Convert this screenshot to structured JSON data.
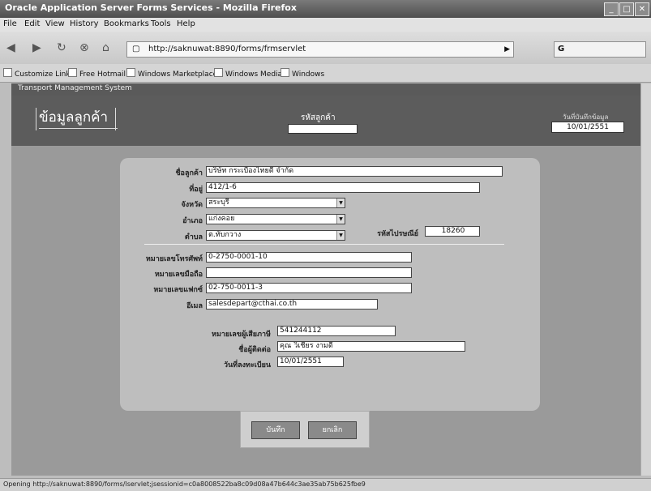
{
  "window": {
    "title": "Oracle Application Server Forms Services - Mozilla Firefox"
  },
  "menu": [
    "File",
    "Edit",
    "View",
    "History",
    "Bookmarks",
    "Tools",
    "Help"
  ],
  "nav": {
    "url": "http://saknuwat:8890/forms/frmservlet",
    "search_placeholder": "G"
  },
  "bookmarks": [
    "Customize Links",
    "Free Hotmail",
    "Windows Marketplace",
    "Windows Media",
    "Windows"
  ],
  "app": {
    "bar_title": "Transport Management System",
    "header_title": "ข้อมูลลูกค้า",
    "customer_code_label": "รหัสลูกค้า",
    "customer_code_value": "",
    "record_date_label": "วันที่บันทึกข้อมูล",
    "record_date_value": "10/01/2551"
  },
  "form": {
    "name": {
      "label": "ชื่อลูกค้า",
      "value": "บริษัท กระเบื้องไทยดี จำกัด"
    },
    "address": {
      "label": "ที่อยู่",
      "value": "412/1-6"
    },
    "province": {
      "label": "จังหวัด",
      "value": "สระบุรี"
    },
    "district": {
      "label": "อำเภอ",
      "value": "แก่งคอย"
    },
    "subdistrict": {
      "label": "ตำบล",
      "value": "ต.ทับกวาง"
    },
    "postcode": {
      "label": "รหัสไปรษณีย์",
      "value": "18260"
    },
    "phone": {
      "label": "หมายเลขโทรศัพท์",
      "value": "0-2750-0001-10"
    },
    "mobile": {
      "label": "หมายเลขมือถือ",
      "value": ""
    },
    "fax": {
      "label": "หมายเลขแฟกซ์",
      "value": "02-750-0011-3"
    },
    "email": {
      "label": "อีเมล",
      "value": "salesdepart@cthai.co.th"
    },
    "taxid": {
      "label": "หมายเลขผู้เสียภาษี",
      "value": "541244112"
    },
    "contact": {
      "label": "ชื่อผู้ติดต่อ",
      "value": "คุณ วิเชียร งามดี"
    },
    "regdate": {
      "label": "วันที่ลงทะเบียน",
      "value": "10/01/2551"
    }
  },
  "buttons": {
    "save": "บันทึก",
    "cancel": "ยกเลิก"
  },
  "status": "Opening http://saknuwat:8890/forms/lservlet;jsessionid=c0a8008522ba8c09d08a47b644c3ae35ab75b625fbe9"
}
